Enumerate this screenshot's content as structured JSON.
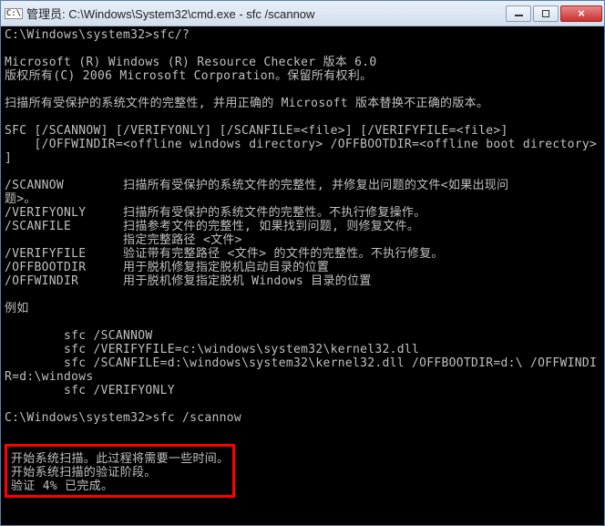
{
  "titlebar": {
    "icon_label": "C:\\",
    "title": "管理员: C:\\Windows\\System32\\cmd.exe - sfc  /scannow"
  },
  "controls": {
    "minimize": "minimize",
    "maximize": "maximize",
    "close": "×"
  },
  "term": {
    "l01": "C:\\Windows\\system32>sfc/?",
    "l02": "",
    "l03": "Microsoft (R) Windows (R) Resource Checker 版本 6.0",
    "l04": "版权所有(C) 2006 Microsoft Corporation。保留所有权利。",
    "l05": "",
    "l06": "扫描所有受保护的系统文件的完整性, 并用正确的 Microsoft 版本替换不正确的版本。",
    "l07": "",
    "l08": "SFC [/SCANNOW] [/VERIFYONLY] [/SCANFILE=<file>] [/VERIFYFILE=<file>]",
    "l09": "    [/OFFWINDIR=<offline windows directory> /OFFBOOTDIR=<offline boot directory>",
    "l10": "]",
    "l11": "",
    "l12a": "/SCANNOW        扫描所有受保护的系统文件的完整性, 并修复出问题的文件<如果出现问",
    "l12b": "题>。",
    "l13": "/VERIFYONLY     扫描所有受保护的系统文件的完整性。不执行修复操作。",
    "l14": "/SCANFILE       扫描参考文件的完整性, 如果找到问题, 则修复文件。",
    "l15": "                指定完整路径 <文件>",
    "l16": "/VERIFYFILE     验证带有完整路径 <文件> 的文件的完整性。不执行修复。",
    "l17": "/OFFBOOTDIR     用于脱机修复指定脱机启动目录的位置",
    "l18": "/OFFWINDIR      用于脱机修复指定脱机 Windows 目录的位置",
    "l19": "",
    "l20": "例如",
    "l21": "",
    "l22": "        sfc /SCANNOW",
    "l23": "        sfc /VERIFYFILE=c:\\windows\\system32\\kernel32.dll",
    "l24": "        sfc /SCANFILE=d:\\windows\\system32\\kernel32.dll /OFFBOOTDIR=d:\\ /OFFWINDI",
    "l25": "R=d:\\windows",
    "l26": "        sfc /VERIFYONLY",
    "l27": "",
    "l28": "C:\\Windows\\system32>sfc /scannow",
    "l29": "",
    "hl1": "开始系统扫描。此过程将需要一些时间。",
    "hl2": "",
    "hl3": "开始系统扫描的验证阶段。",
    "hl4": "验证 4% 已完成。"
  }
}
